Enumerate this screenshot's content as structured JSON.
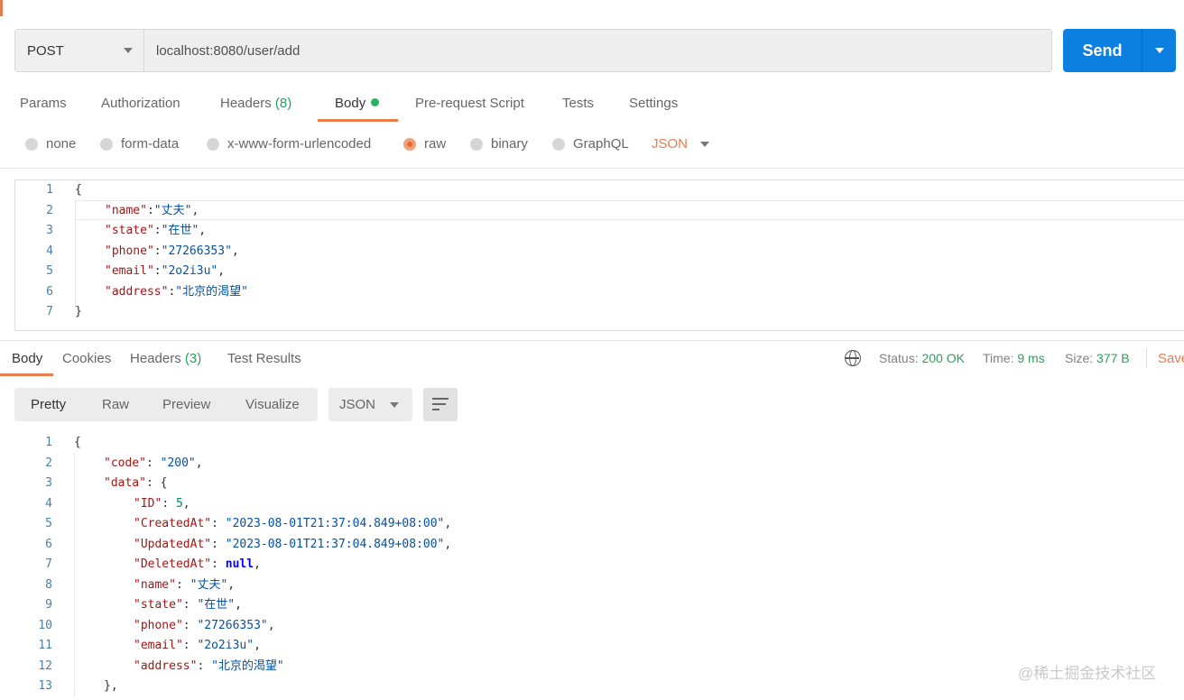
{
  "request": {
    "method": "POST",
    "url": "localhost:8080/user/add",
    "send_label": "Send"
  },
  "request_tabs": [
    {
      "label": "Params",
      "count": ""
    },
    {
      "label": "Authorization",
      "count": ""
    },
    {
      "label": "Headers",
      "count": "(8)"
    },
    {
      "label": "Body",
      "count": ""
    },
    {
      "label": "Pre-request Script",
      "count": ""
    },
    {
      "label": "Tests",
      "count": ""
    },
    {
      "label": "Settings",
      "count": ""
    }
  ],
  "body_types": [
    {
      "label": "none",
      "selected": false
    },
    {
      "label": "form-data",
      "selected": false
    },
    {
      "label": "x-www-form-urlencoded",
      "selected": false
    },
    {
      "label": "raw",
      "selected": true
    },
    {
      "label": "binary",
      "selected": false
    },
    {
      "label": "GraphQL",
      "selected": false
    }
  ],
  "raw_format": "JSON",
  "request_body_lines": [
    {
      "n": "1",
      "indent": 0,
      "key": "",
      "sep": "",
      "val": "",
      "tail": "{"
    },
    {
      "n": "2",
      "indent": 1,
      "key": "\"name\"",
      "sep": ":",
      "val": "\"丈夫\"",
      "tail": ","
    },
    {
      "n": "3",
      "indent": 1,
      "key": "\"state\"",
      "sep": ":",
      "val": "\"在世\"",
      "tail": ","
    },
    {
      "n": "4",
      "indent": 1,
      "key": "\"phone\"",
      "sep": ":",
      "val": "\"27266353\"",
      "tail": ","
    },
    {
      "n": "5",
      "indent": 1,
      "key": "\"email\"",
      "sep": ":",
      "val": "\"2o2i3u\"",
      "tail": ","
    },
    {
      "n": "6",
      "indent": 1,
      "key": "\"address\"",
      "sep": ":",
      "val": "\"北京的渴望\"",
      "tail": ""
    },
    {
      "n": "7",
      "indent": 0,
      "key": "",
      "sep": "",
      "val": "",
      "tail": "}"
    }
  ],
  "response_tabs": [
    {
      "label": "Body",
      "count": ""
    },
    {
      "label": "Cookies",
      "count": ""
    },
    {
      "label": "Headers",
      "count": "(3)"
    },
    {
      "label": "Test Results",
      "count": ""
    }
  ],
  "response_status": {
    "status_label": "Status:",
    "status_value": "200 OK",
    "time_label": "Time:",
    "time_value": "9 ms",
    "size_label": "Size:",
    "size_value": "377 B",
    "save_label": "Save"
  },
  "response_views": [
    "Pretty",
    "Raw",
    "Preview",
    "Visualize"
  ],
  "response_format": "JSON",
  "response_body_lines": [
    {
      "n": "1",
      "indent": 0,
      "key": "",
      "sep": "",
      "val": "",
      "vt": "",
      "tail": "{"
    },
    {
      "n": "2",
      "indent": 1,
      "key": "\"code\"",
      "sep": ": ",
      "val": "\"200\"",
      "vt": "s",
      "tail": ","
    },
    {
      "n": "3",
      "indent": 1,
      "key": "\"data\"",
      "sep": ": ",
      "val": "",
      "vt": "",
      "tail": "{"
    },
    {
      "n": "4",
      "indent": 2,
      "key": "\"ID\"",
      "sep": ": ",
      "val": "5",
      "vt": "num",
      "tail": ","
    },
    {
      "n": "5",
      "indent": 2,
      "key": "\"CreatedAt\"",
      "sep": ": ",
      "val": "\"2023-08-01T21:37:04.849+08:00\"",
      "vt": "s",
      "tail": ","
    },
    {
      "n": "6",
      "indent": 2,
      "key": "\"UpdatedAt\"",
      "sep": ": ",
      "val": "\"2023-08-01T21:37:04.849+08:00\"",
      "vt": "s",
      "tail": ","
    },
    {
      "n": "7",
      "indent": 2,
      "key": "\"DeletedAt\"",
      "sep": ": ",
      "val": "null",
      "vt": "nul",
      "tail": ","
    },
    {
      "n": "8",
      "indent": 2,
      "key": "\"name\"",
      "sep": ": ",
      "val": "\"丈夫\"",
      "vt": "s",
      "tail": ","
    },
    {
      "n": "9",
      "indent": 2,
      "key": "\"state\"",
      "sep": ": ",
      "val": "\"在世\"",
      "vt": "s",
      "tail": ","
    },
    {
      "n": "10",
      "indent": 2,
      "key": "\"phone\"",
      "sep": ": ",
      "val": "\"27266353\"",
      "vt": "s",
      "tail": ","
    },
    {
      "n": "11",
      "indent": 2,
      "key": "\"email\"",
      "sep": ": ",
      "val": "\"2o2i3u\"",
      "vt": "s",
      "tail": ","
    },
    {
      "n": "12",
      "indent": 2,
      "key": "\"address\"",
      "sep": ": ",
      "val": "\"北京的渴望\"",
      "vt": "s",
      "tail": ""
    },
    {
      "n": "13",
      "indent": 1,
      "key": "",
      "sep": "",
      "val": "",
      "vt": "",
      "tail": "},"
    }
  ],
  "watermark": "@稀土掘金技术社区",
  "colors": {
    "accent": "#e87c4d",
    "send": "#0d7fe0",
    "success": "#2b9f5a"
  }
}
